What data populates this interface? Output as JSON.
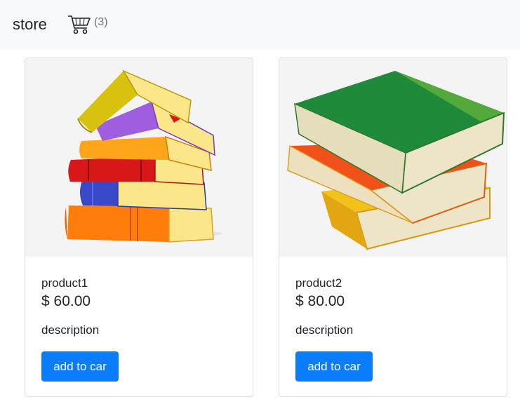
{
  "navbar": {
    "brand": "store",
    "cart_icon": "shopping-cart-icon",
    "cart_count": "(3)"
  },
  "products": [
    {
      "image": "book-stack-illustration",
      "name": "product1",
      "price": "$ 60.00",
      "description": "description",
      "button_label": "add to car"
    },
    {
      "image": "books-pile-illustration",
      "name": "product2",
      "price": "$ 80.00",
      "description": "description",
      "button_label": "add to car"
    }
  ],
  "colors": {
    "navbar_bg": "#f8f9fa",
    "button_bg": "#0b7dfb",
    "image_bg": "#f4f4f4"
  }
}
